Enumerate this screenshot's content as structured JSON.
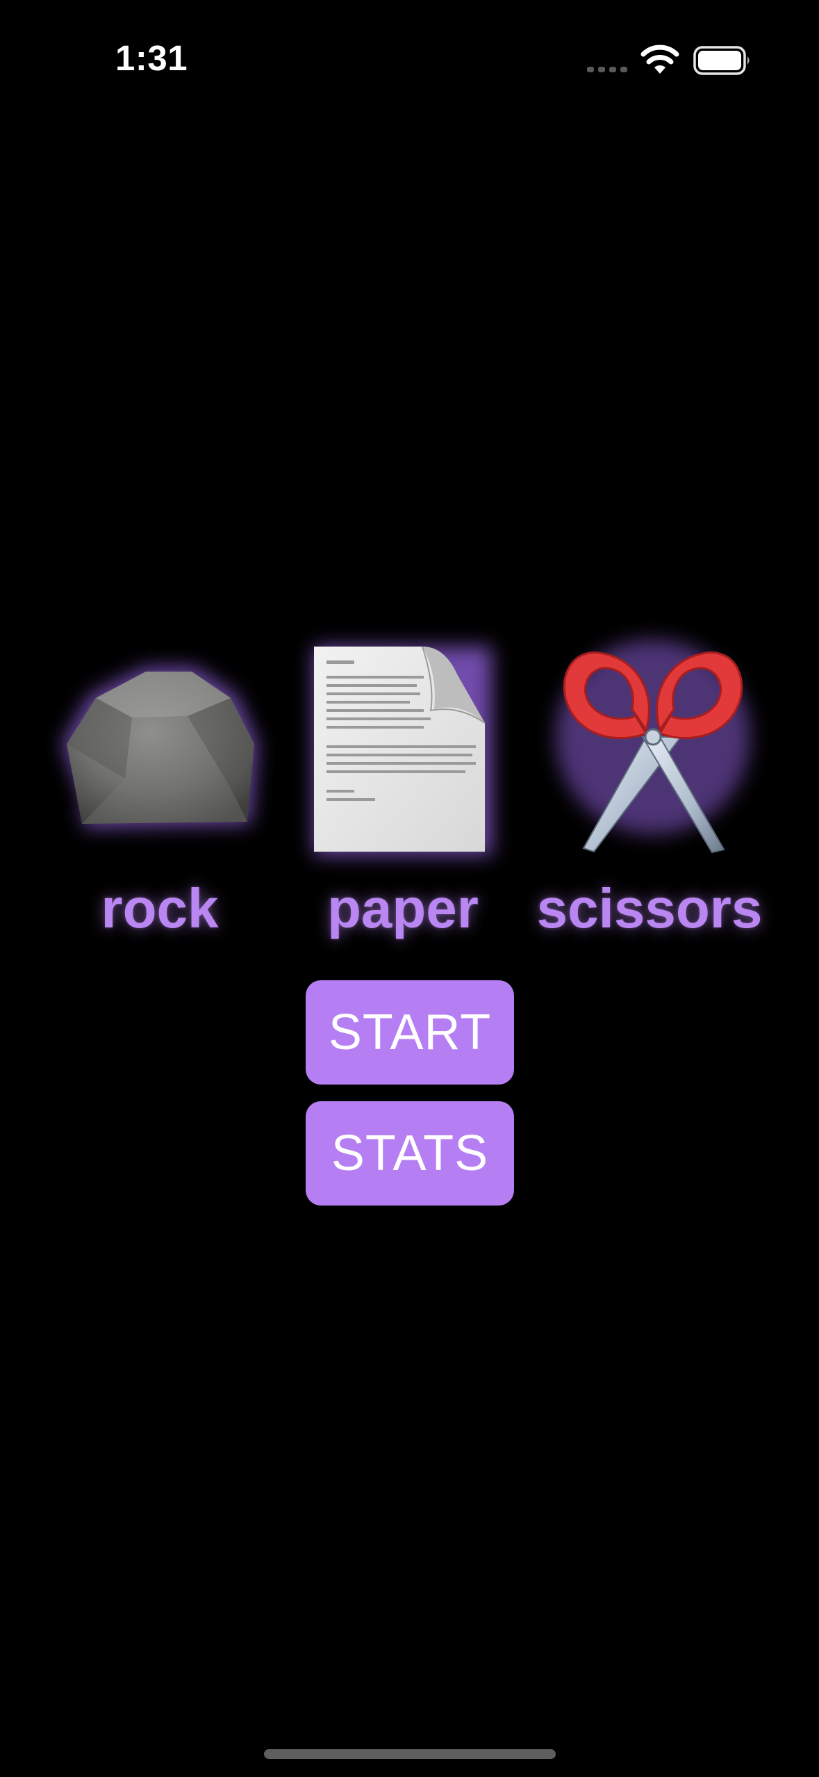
{
  "status_bar": {
    "time": "1:31",
    "signal_icon": "cellular-dots-icon",
    "wifi_icon": "wifi-icon",
    "battery_icon": "battery-icon"
  },
  "choices": [
    {
      "id": "rock",
      "label": "rock",
      "icon": "rock-icon"
    },
    {
      "id": "paper",
      "label": "paper",
      "icon": "paper-document-icon"
    },
    {
      "id": "scissors",
      "label": "scissors",
      "icon": "scissors-icon"
    }
  ],
  "buttons": {
    "start_label": "START",
    "stats_label": "STATS"
  },
  "colors": {
    "background": "#000000",
    "accent": "#B57EF2",
    "label": "#BA87F2",
    "glow": "#A070E0"
  }
}
